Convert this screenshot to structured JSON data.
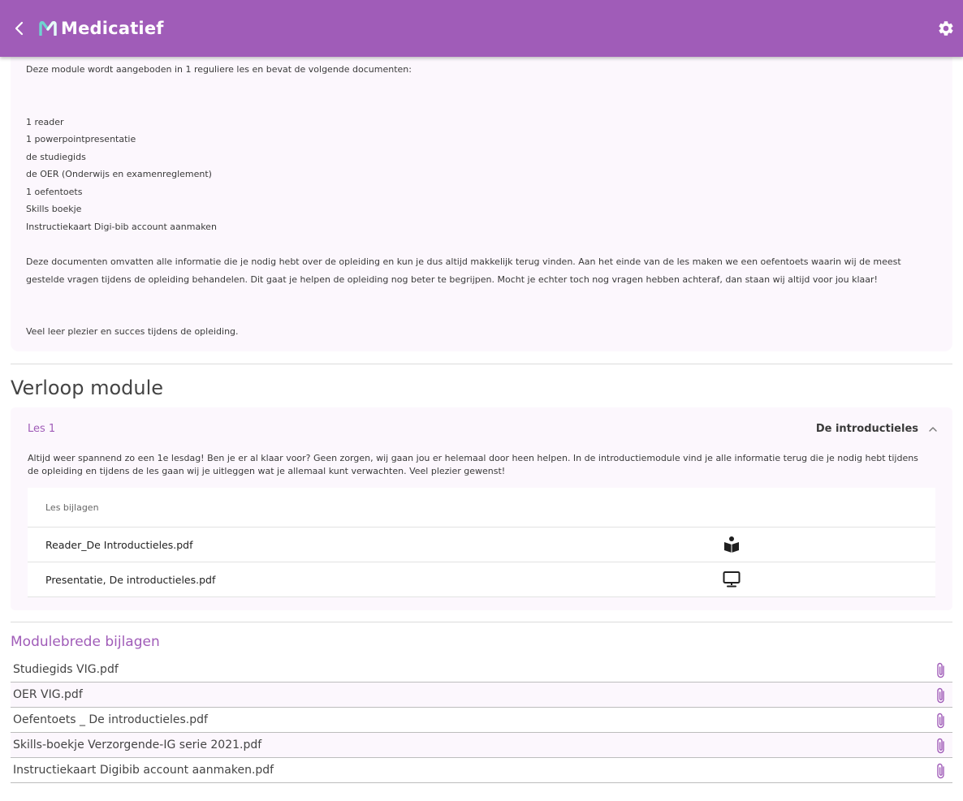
{
  "header": {
    "brand": "Medicatief",
    "back_icon": "chevron-left-icon",
    "settings_icon": "gear-icon",
    "color": "#a05cb8"
  },
  "intro": {
    "lead": "Deze module wordt aangeboden in 1 reguliere les en bevat de volgende documenten:",
    "documents": [
      "1 reader",
      "1 powerpointpresentatie",
      "de studiegids",
      "de OER (Onderwijs en examenreglement)",
      "1 oefentoets",
      "Skills boekje",
      "Instructiekaart Digi-bib account aanmaken"
    ],
    "paragraph": "Deze documenten omvatten alle informatie die je nodig hebt over de opleiding en kun je dus altijd makkelijk terug vinden. Aan het einde van de les maken we een oefentoets waarin wij de meest gestelde vragen tijdens de opleiding behandelen. Dit gaat je helpen de opleiding nog beter te begrijpen. Mocht je echter toch nog vragen hebben achteraf, dan staan wij altijd voor jou klaar!",
    "closing": "Veel leer plezier en succes tijdens de opleiding."
  },
  "verloop": {
    "title": "Verloop module",
    "les": {
      "number": "Les 1",
      "title": "De introductieles",
      "description": "Altijd weer spannend zo een 1e lesdag! Ben je er al klaar voor? Geen zorgen, wij gaan jou er helemaal door heen helpen. In de introductiemodule vind je alle informatie terug die je nodig hebt tijdens de opleiding en tijdens de les gaan wij je uitleggen wat je allemaal kunt verwachten. Veel plezier gewenst!",
      "attachments_header": "Les bijlagen",
      "attachments": [
        {
          "name": "Reader_De Introductieles.pdf",
          "icon": "reader-icon"
        },
        {
          "name": "Presentatie, De introductieles.pdf",
          "icon": "monitor-icon"
        }
      ]
    }
  },
  "module_attachments": {
    "title": "Modulebrede bijlagen",
    "items": [
      "Studiegids VIG.pdf",
      "OER VIG.pdf",
      "Oefentoets _ De introductieles.pdf",
      "Skills-boekje Verzorgende-IG serie 2021.pdf",
      "Instructiekaart Digibib account aanmaken.pdf"
    ],
    "icon": "paperclip-icon"
  }
}
